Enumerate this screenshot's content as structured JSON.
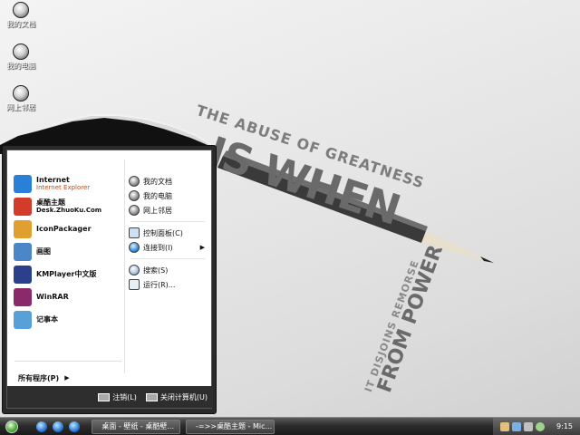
{
  "wallpaper": {
    "line1": "THE ABUSE OF GREATNESS",
    "line2": "IS WHEN",
    "line3": "IT DISJOINS REMORSE",
    "line4": "FROM POWER"
  },
  "desktop_icons": [
    {
      "label": "我的文档",
      "icon": "my-documents-icon"
    },
    {
      "label": "我的电脑",
      "icon": "my-computer-icon"
    },
    {
      "label": "网上邻居",
      "icon": "network-places-icon"
    }
  ],
  "start_menu": {
    "pinned": [
      {
        "title": "Internet",
        "subtitle": "Internet Explorer",
        "icon": "internet-explorer-icon",
        "color": "#2a7fd6"
      },
      {
        "title": "桌酷主题",
        "subtitle": "Desk.ZhuoKu.Com",
        "icon": "zhuoku-theme-icon",
        "color": "#d23c2a"
      }
    ],
    "recent": [
      {
        "title": "IconPackager",
        "icon": "iconpackager-icon",
        "color": "#e0a030"
      },
      {
        "title": "画图",
        "icon": "paint-icon",
        "color": "#4a86c8"
      },
      {
        "title": "KMPlayer中文版",
        "icon": "kmplayer-icon",
        "color": "#2b3f8a"
      },
      {
        "title": "WinRAR",
        "icon": "winrar-icon",
        "color": "#8b2a6a"
      },
      {
        "title": "记事本",
        "icon": "notepad-icon",
        "color": "#5aa0d8"
      }
    ],
    "right_items_1": [
      {
        "label": "我的文档",
        "icon": "my-documents-icon"
      },
      {
        "label": "我的电脑",
        "icon": "my-computer-icon"
      },
      {
        "label": "网上邻居",
        "icon": "network-places-icon"
      }
    ],
    "right_items_2": [
      {
        "label": "控制面板(C)",
        "icon": "control-panel-icon",
        "arrow": ""
      },
      {
        "label": "连接到(I)",
        "icon": "connect-to-icon",
        "arrow": "▶"
      }
    ],
    "right_items_3": [
      {
        "label": "搜索(S)",
        "icon": "search-icon"
      },
      {
        "label": "运行(R)...",
        "icon": "run-icon"
      }
    ],
    "all_programs": "所有程序(P)",
    "all_programs_arrow": "▶",
    "logoff": "注销(L)",
    "shutdown": "关闭计算机(U)"
  },
  "taskbar": {
    "tasks": [
      {
        "label": "桌面 - 壁纸 - 桌酷壁...",
        "icon": "browser-icon"
      },
      {
        "label": "-=>>桌酷主题 - Mic...",
        "icon": "word-icon"
      }
    ],
    "clock": "9:15"
  }
}
